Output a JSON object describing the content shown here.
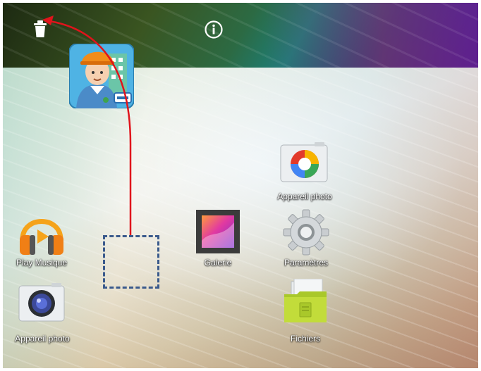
{
  "apps": {
    "appareil_photo_top": {
      "label": "Appareil photo"
    },
    "play_musique": {
      "label": "Play Musique"
    },
    "galerie": {
      "label": "Galerie"
    },
    "parametres": {
      "label": "Paramètres"
    },
    "appareil_photo_bottom": {
      "label": "Appareil photo"
    },
    "fichiers": {
      "label": "Fichiers"
    }
  },
  "colors": {
    "arrow": "#e0141c",
    "drop_box": "#3a5a8c"
  }
}
